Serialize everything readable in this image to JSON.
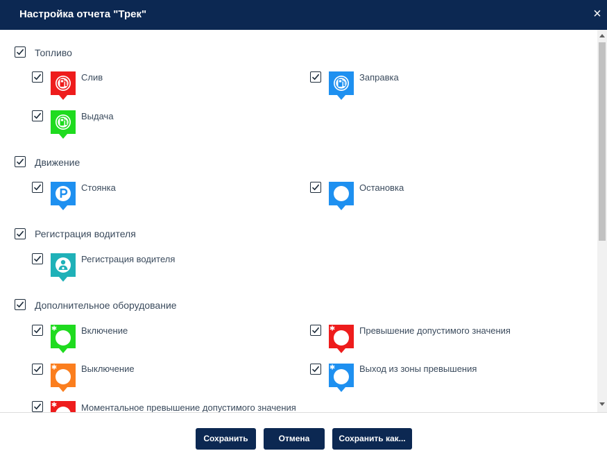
{
  "dialog": {
    "title": "Настройка отчета \"Трек\"",
    "close_glyph": "×"
  },
  "colors": {
    "header_bg": "#0c2852",
    "button_bg": "#0c2852",
    "red": "#ee1c1c",
    "green": "#1fdb1f",
    "blue": "#1e90f0",
    "teal": "#1fb1b8",
    "orange": "#fb7e1e"
  },
  "groups": [
    {
      "label": "Топливо",
      "checked": true,
      "items": [
        {
          "label": "Слив",
          "checked": true,
          "color": "#ee1c1c",
          "icon": "fuel-pump-icon"
        },
        {
          "label": "Заправка",
          "checked": true,
          "color": "#1e90f0",
          "icon": "fuel-pump-icon"
        },
        {
          "label": "Выдача",
          "checked": true,
          "color": "#1fdb1f",
          "icon": "fuel-pump-icon"
        }
      ]
    },
    {
      "label": "Движение",
      "checked": true,
      "items": [
        {
          "label": "Стоянка",
          "checked": true,
          "color": "#1e90f0",
          "icon": "parking-icon"
        },
        {
          "label": "Остановка",
          "checked": true,
          "color": "#1e90f0",
          "icon": "circle-icon"
        }
      ]
    },
    {
      "label": "Регистрация водителя",
      "checked": true,
      "items": [
        {
          "label": "Регистрация водителя",
          "checked": true,
          "color": "#1fb1b8",
          "icon": "driver-icon"
        }
      ]
    },
    {
      "label": "Дополнительное оборудование",
      "checked": true,
      "items": [
        {
          "label": "Включение",
          "checked": true,
          "color": "#1fdb1f",
          "icon": "circle-star-icon"
        },
        {
          "label": "Превышение допустимого значения",
          "checked": true,
          "color": "#ee1c1c",
          "icon": "circle-star-icon"
        },
        {
          "label": "Выключение",
          "checked": true,
          "color": "#fb7e1e",
          "icon": "circle-star-icon"
        },
        {
          "label": "Выход из зоны превышения",
          "checked": true,
          "color": "#1e90f0",
          "icon": "circle-star-icon"
        },
        {
          "label": "Моментальное превышение допустимого значения",
          "checked": true,
          "color": "#ee1c1c",
          "icon": "circle-star-icon"
        }
      ]
    }
  ],
  "buttons": {
    "save": "Сохранить",
    "cancel": "Отмена",
    "save_as": "Сохранить как..."
  }
}
